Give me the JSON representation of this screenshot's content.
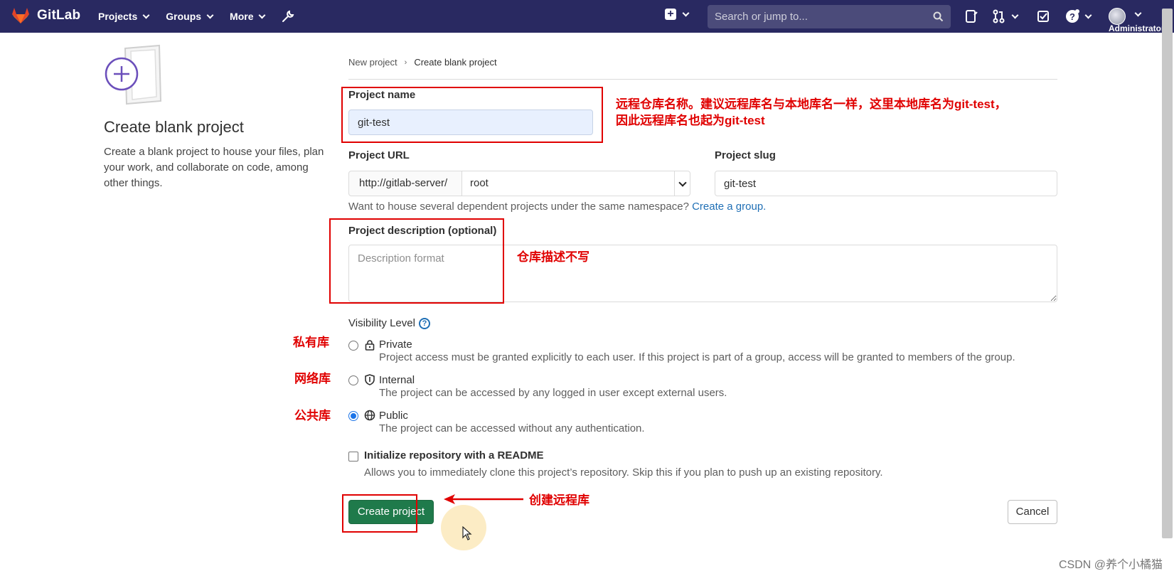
{
  "navbar": {
    "brand": "GitLab",
    "menu": [
      {
        "label": "Projects"
      },
      {
        "label": "Groups"
      },
      {
        "label": "More"
      }
    ],
    "search_placeholder": "Search or jump to...",
    "user_label": "Administrator"
  },
  "sidebar": {
    "title": "Create blank project",
    "description": "Create a blank project to house your files, plan your work, and collaborate on code, among other things."
  },
  "breadcrumb": {
    "parent": "New project",
    "current": "Create blank project"
  },
  "form": {
    "project_name_label": "Project name",
    "project_name_value": "git-test",
    "project_url_label": "Project URL",
    "url_prefix": "http://gitlab-server/",
    "namespace_value": "root",
    "project_slug_label": "Project slug",
    "project_slug_value": "git-test",
    "namespace_hint": "Want to house several dependent projects under the same namespace?",
    "create_group_link": "Create a group.",
    "description_label": "Project description (optional)",
    "description_placeholder": "Description format",
    "visibility_label": "Visibility Level",
    "visibility_help_icon": "?",
    "visibility_options": [
      {
        "title": "Private",
        "description": "Project access must be granted explicitly to each user. If this project is part of a group, access will be granted to members of the group.",
        "icon": "lock-icon",
        "selected": false
      },
      {
        "title": "Internal",
        "description": "The project can be accessed by any logged in user except external users.",
        "icon": "shield-icon",
        "selected": false
      },
      {
        "title": "Public",
        "description": "The project can be accessed without any authentication.",
        "icon": "globe-icon",
        "selected": true
      }
    ],
    "readme_title": "Initialize repository with a README",
    "readme_description": "Allows you to immediately clone this project’s repository. Skip this if you plan to push up an existing repository.",
    "readme_checked": false,
    "create_button": "Create project",
    "cancel_button": "Cancel"
  },
  "annotations": {
    "project_name_note_line1": "远程仓库名称。建议远程库名与本地库名一样，这里本地库名为git-test，",
    "project_name_note_line2": "因此远程库名也起为git-test",
    "description_note": "仓库描述不写",
    "private_note": "私有库",
    "internal_note": "网络库",
    "public_note": "公共库",
    "create_note": "创建远程库",
    "color": "#e00000"
  },
  "watermark": "CSDN @养个小橘猫",
  "colors": {
    "navbar": "#292961",
    "primary_button": "#1f7a4b",
    "link": "#1f6fb5"
  }
}
